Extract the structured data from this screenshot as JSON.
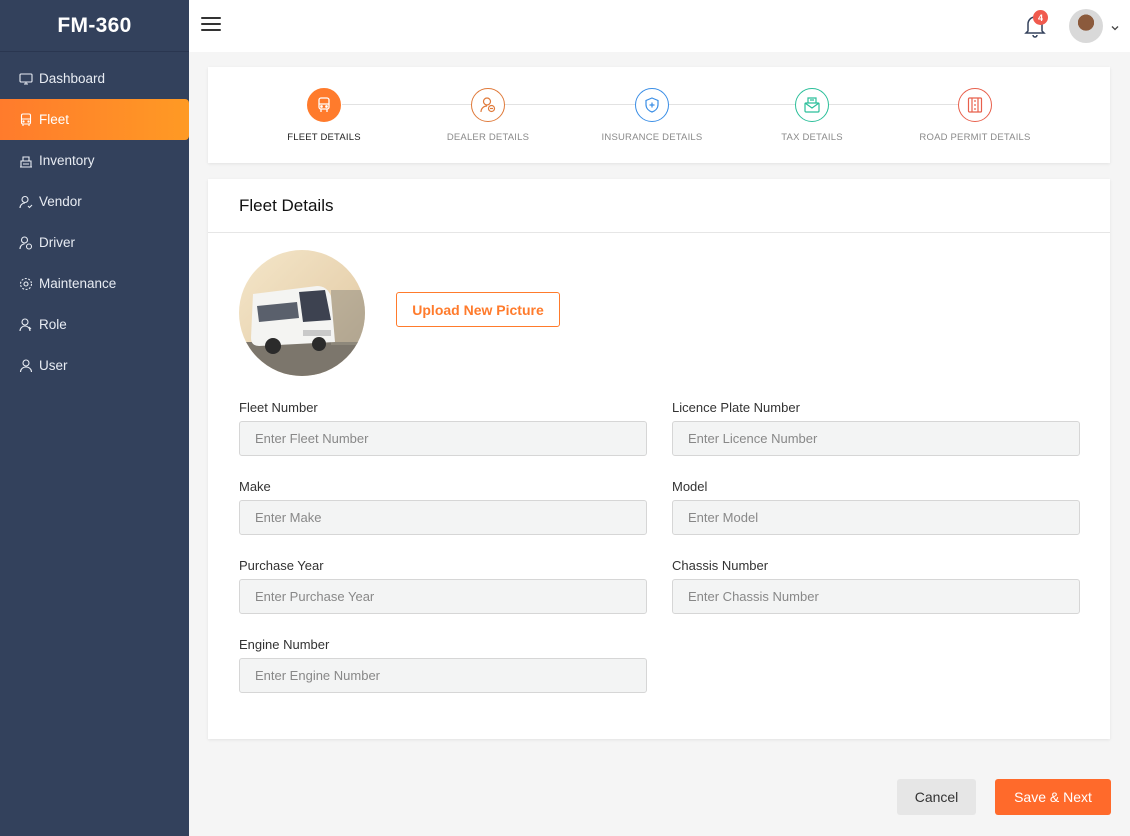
{
  "app": {
    "brand": "FM-360"
  },
  "sidebar": {
    "items": [
      {
        "label": "Dashboard",
        "icon": "monitor-icon"
      },
      {
        "label": "Fleet",
        "icon": "bus-icon",
        "active": true
      },
      {
        "label": "Inventory",
        "icon": "inventory-icon"
      },
      {
        "label": "Vendor",
        "icon": "vendor-icon"
      },
      {
        "label": "Driver",
        "icon": "driver-icon"
      },
      {
        "label": "Maintenance",
        "icon": "gear-icon"
      },
      {
        "label": "Role",
        "icon": "role-icon"
      },
      {
        "label": "User",
        "icon": "user-icon"
      }
    ]
  },
  "topbar": {
    "notification_count": "4"
  },
  "stepper": {
    "steps": [
      {
        "label": "FLEET DETAILS",
        "icon": "bus-icon",
        "color": "#ff7b2c",
        "active": true
      },
      {
        "label": "DEALER DETAILS",
        "icon": "dealer-icon",
        "color": "#e07a3a"
      },
      {
        "label": "INSURANCE DETAILS",
        "icon": "shield-icon",
        "color": "#3a8ee6"
      },
      {
        "label": "TAX DETAILS",
        "icon": "tax-envelope-icon",
        "color": "#2bbf9a"
      },
      {
        "label": "ROAD PERMIT DETAILS",
        "icon": "road-permit-icon",
        "color": "#e8604c"
      }
    ]
  },
  "form": {
    "title": "Fleet Details",
    "upload_label": "Upload New Picture",
    "fields": [
      {
        "label": "Fleet Number",
        "placeholder": "Enter Fleet Number"
      },
      {
        "label": "Licence Plate Number",
        "placeholder": "Enter Licence Number"
      },
      {
        "label": "Make",
        "placeholder": "Enter Make"
      },
      {
        "label": "Model",
        "placeholder": "Enter Model"
      },
      {
        "label": "Purchase Year",
        "placeholder": "Enter Purchase Year"
      },
      {
        "label": "Chassis Number",
        "placeholder": "Enter Chassis Number"
      },
      {
        "label": "Engine Number",
        "placeholder": "Enter Engine Number"
      }
    ]
  },
  "actions": {
    "cancel_label": "Cancel",
    "save_label": "Save & Next"
  },
  "colors": {
    "accent": "#ff7b2c",
    "sidebar": "#33415c"
  }
}
